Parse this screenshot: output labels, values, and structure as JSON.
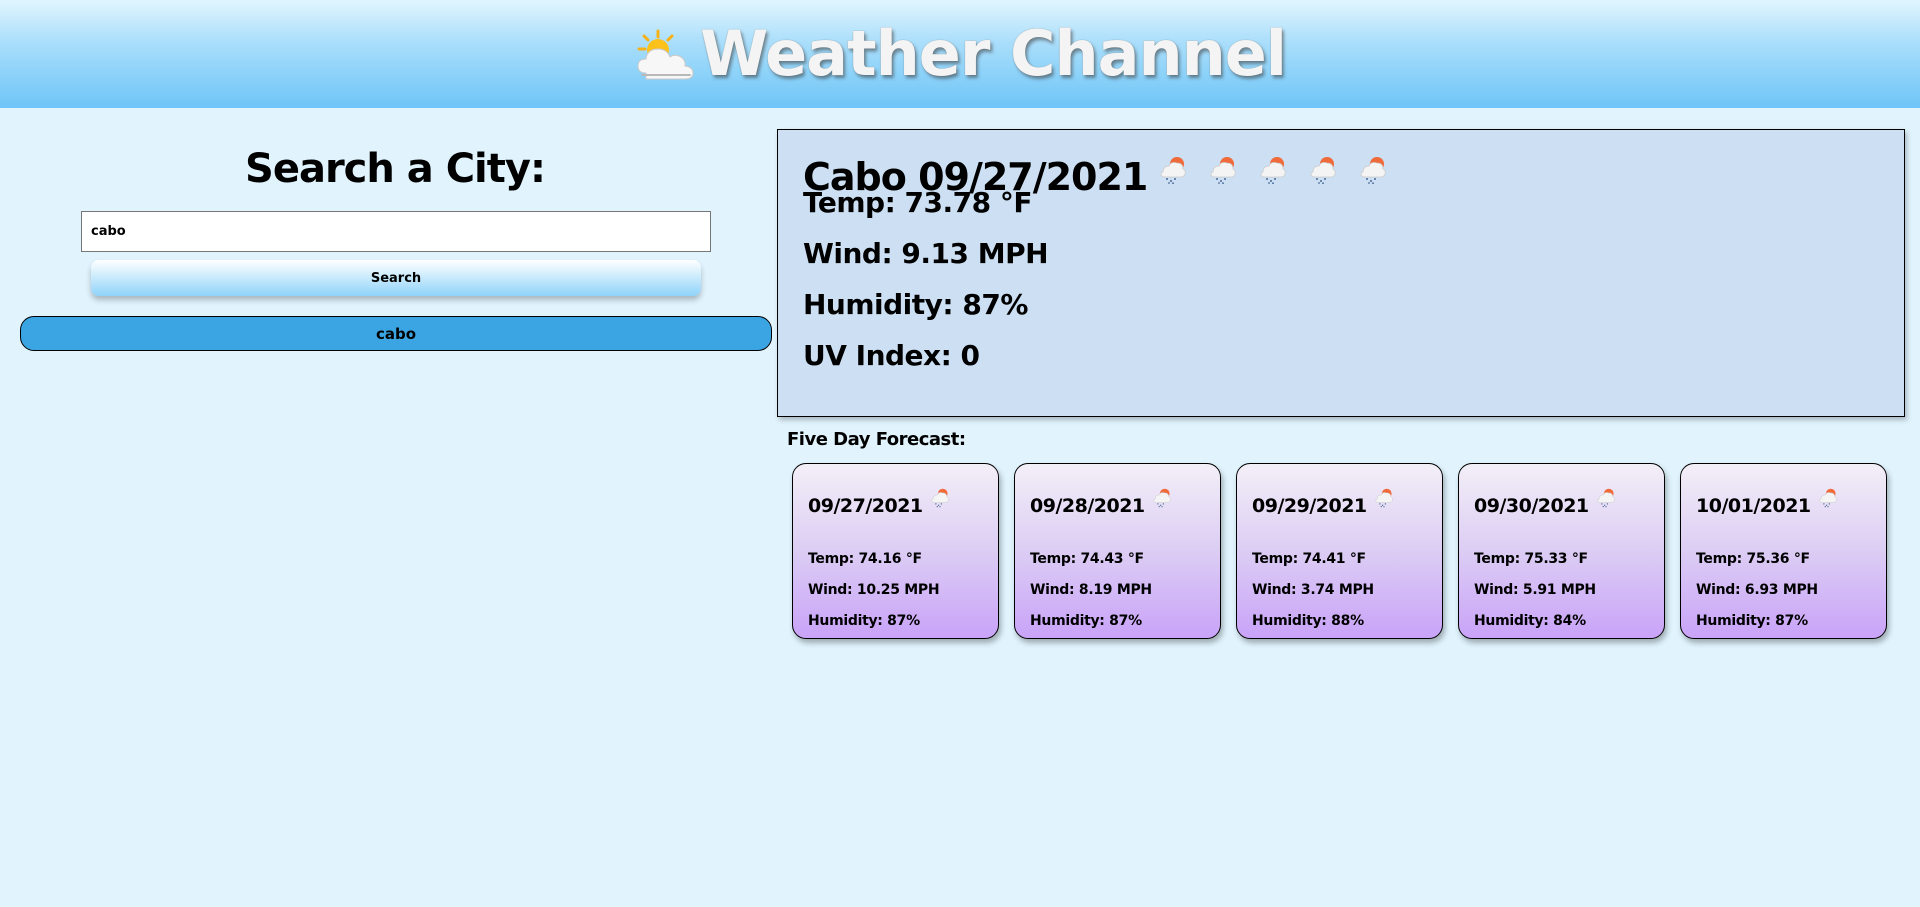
{
  "header": {
    "title": "Weather Channel",
    "logo_icon": "sun-behind-cloud-icon"
  },
  "search": {
    "heading": "Search a City:",
    "input_value": "cabo",
    "button_label": "Search",
    "history": [
      "cabo"
    ]
  },
  "current": {
    "title": "Cabo 09/27/2021",
    "icon": "rain-cloud-icon",
    "temp": "Temp: 73.78 °F",
    "wind": "Wind: 9.13 MPH",
    "humidity": "Humidity: 87%",
    "uv": "UV Index: 0"
  },
  "forecast": {
    "heading": "Five Day Forecast:",
    "days": [
      {
        "date": "09/27/2021",
        "temp": "Temp: 74.16 °F",
        "wind": "Wind: 10.25 MPH",
        "humidity": "Humidity: 87%"
      },
      {
        "date": "09/28/2021",
        "temp": "Temp: 74.43 °F",
        "wind": "Wind: 8.19 MPH",
        "humidity": "Humidity: 87%"
      },
      {
        "date": "09/29/2021",
        "temp": "Temp: 74.41 °F",
        "wind": "Wind: 3.74 MPH",
        "humidity": "Humidity: 88%"
      },
      {
        "date": "09/30/2021",
        "temp": "Temp: 75.33 °F",
        "wind": "Wind: 5.91 MPH",
        "humidity": "Humidity: 84%"
      },
      {
        "date": "10/01/2021",
        "temp": "Temp: 75.36 °F",
        "wind": "Wind: 6.93 MPH",
        "humidity": "Humidity: 87%"
      }
    ]
  },
  "colors": {
    "page_bg": "#e1f4fe",
    "history_button": "#3aa5e2",
    "current_panel": "#cde0f3",
    "card_bottom": "#c9a3f8"
  }
}
